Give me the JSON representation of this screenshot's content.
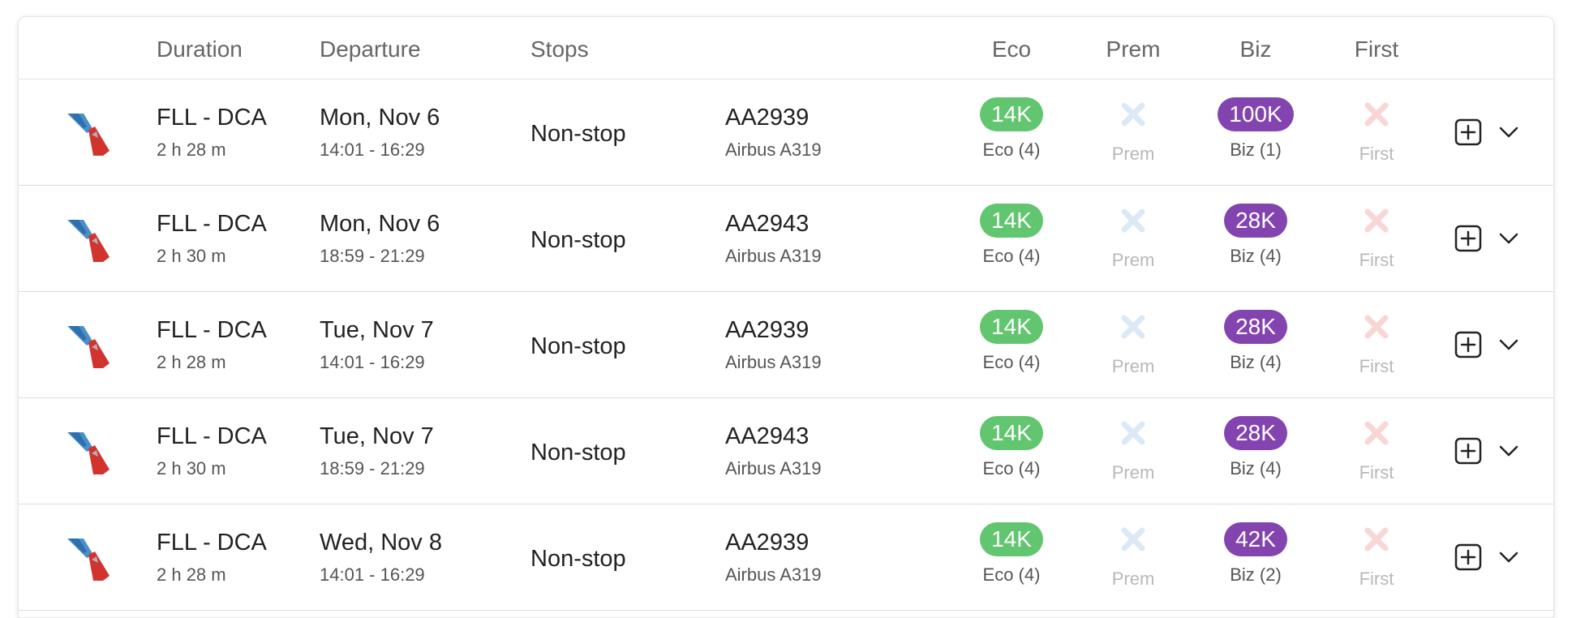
{
  "header": {
    "duration": "Duration",
    "departure": "Departure",
    "stops": "Stops",
    "eco": "Eco",
    "prem": "Prem",
    "biz": "Biz",
    "first": "First"
  },
  "colors": {
    "eco_pill": "#62c56f",
    "biz_pill": "#8444b0",
    "prem_unavailable": "#dbe9f7",
    "first_unavailable": "#f9d6d6"
  },
  "icons": {
    "airline_logo": "american-airlines-logo-icon",
    "unavailable": "x-icon",
    "add": "plus-square-icon",
    "expand": "chevron-down-icon"
  },
  "rows": [
    {
      "route": "FLL - DCA",
      "duration": "2 h 28 m",
      "date": "Mon, Nov 6",
      "times": "14:01 - 16:29",
      "stops": "Non-stop",
      "flight": "AA2939",
      "aircraft": "Airbus A319",
      "eco_price": "14K",
      "eco_label": "Eco (4)",
      "prem_label": "Prem",
      "biz_price": "100K",
      "biz_label": "Biz (1)",
      "first_label": "First"
    },
    {
      "route": "FLL - DCA",
      "duration": "2 h 30 m",
      "date": "Mon, Nov 6",
      "times": "18:59 - 21:29",
      "stops": "Non-stop",
      "flight": "AA2943",
      "aircraft": "Airbus A319",
      "eco_price": "14K",
      "eco_label": "Eco (4)",
      "prem_label": "Prem",
      "biz_price": "28K",
      "biz_label": "Biz (4)",
      "first_label": "First"
    },
    {
      "route": "FLL - DCA",
      "duration": "2 h 28 m",
      "date": "Tue, Nov 7",
      "times": "14:01 - 16:29",
      "stops": "Non-stop",
      "flight": "AA2939",
      "aircraft": "Airbus A319",
      "eco_price": "14K",
      "eco_label": "Eco (4)",
      "prem_label": "Prem",
      "biz_price": "28K",
      "biz_label": "Biz (4)",
      "first_label": "First"
    },
    {
      "route": "FLL - DCA",
      "duration": "2 h 30 m",
      "date": "Tue, Nov 7",
      "times": "18:59 - 21:29",
      "stops": "Non-stop",
      "flight": "AA2943",
      "aircraft": "Airbus A319",
      "eco_price": "14K",
      "eco_label": "Eco (4)",
      "prem_label": "Prem",
      "biz_price": "28K",
      "biz_label": "Biz (4)",
      "first_label": "First"
    },
    {
      "route": "FLL - DCA",
      "duration": "2 h 28 m",
      "date": "Wed, Nov 8",
      "times": "14:01 - 16:29",
      "stops": "Non-stop",
      "flight": "AA2939",
      "aircraft": "Airbus A319",
      "eco_price": "14K",
      "eco_label": "Eco (4)",
      "prem_label": "Prem",
      "biz_price": "42K",
      "biz_label": "Biz (2)",
      "first_label": "First"
    }
  ]
}
